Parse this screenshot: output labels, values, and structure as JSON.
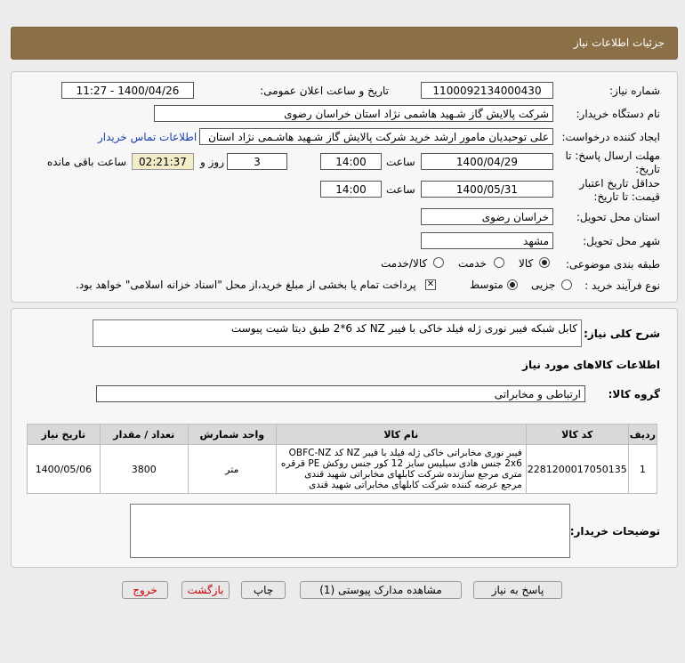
{
  "header": {
    "title": "جزئیات اطلاعات نیاز"
  },
  "form": {
    "need_number_label": "شماره نیاز:",
    "need_number": "1100092134000430",
    "announce_label": "تاریخ و ساعت اعلان عمومی:",
    "announce_value": "1400/04/26 - 11:27",
    "buyer_org_label": "نام دستگاه خریدار:",
    "buyer_org": "شرکت پالایش گاز شـهید هاشمی نژاد   استان خراسان رضوی",
    "requester_label": "ایجاد کننده درخواست:",
    "requester": "علی توحیدیان مامور ارشد خرید شرکت پالایش گاز شـهید هاشـمی نژاد   استان",
    "contact_link": "اطلاعات تماس خریدار",
    "reply_deadline_label": "مهلت ارسال پاسخ: تا تاریخ:",
    "reply_date": "1400/04/29",
    "time_label": "ساعت",
    "reply_time": "14:00",
    "days_value": "3",
    "days_label": "روز و",
    "remaining_time": "02:21:37",
    "remaining_label": "ساعت باقی مانده",
    "validity_label": "حداقل تاریخ اعتبار قیمت: تا تاریخ:",
    "validity_date": "1400/05/31",
    "validity_time": "14:00",
    "province_label": "استان محل تحویل:",
    "province": "خراسان رضوی",
    "city_label": "شهر محل تحویل:",
    "city": "مشهد",
    "category_label": "طبقه بندی موضوعی:",
    "category_options": [
      "کالا",
      "خدمت",
      "کالا/خدمت"
    ],
    "process_label": "نوع فرآیند خرید :",
    "process_options": [
      "جزیی",
      "متوسط"
    ],
    "payment_note": "پرداخت تمام یا بخشی از مبلغ خرید،از محل \"اسناد خزانه اسلامی\" خواهد بود."
  },
  "details": {
    "summary_label": "شرح کلی نیاز:",
    "summary": "کابل شبکه فیبر نوری  ژله فیلد خاکی با فیبر NZ کد 6*2 طبق دیتا شیت پیوست",
    "goods_info_title": "اطلاعات کالاهای مورد نیاز",
    "group_label": "گروه کالا:",
    "group": "ارتباطی و مخابراتی",
    "table": {
      "headers": [
        "ردیف",
        "کد کالا",
        "نام کالا",
        "واحد شمارش",
        "تعداد / مقدار",
        "تاریخ نیاز"
      ],
      "rows": [
        {
          "row": "1",
          "code": "2281200017050135",
          "name_lines": [
            "فیبر نوری مخابراتی خاکی ژله فیلد با فیبر NZ کد OBFC-NZ",
            "2x6 جنس هادی سیلیس سایز 12 کور جنس روکش PE قرقره",
            "متری مرجع سازنده شرکت کابلهای مخابراتی شهید قندی",
            "مرجع عرضه کننده شرکت کابلهای مخابراتی شهید قندی"
          ],
          "unit": "متر",
          "qty": "3800",
          "date": "1400/05/06"
        }
      ]
    },
    "buyer_notes_label": "توضیحات خریدار:"
  },
  "buttons": {
    "reply": "پاسخ به نیاز",
    "view_docs": "مشاهده مدارک پیوستی (1)",
    "print": "چاپ",
    "back": "بازگشت",
    "exit": "خروج"
  }
}
